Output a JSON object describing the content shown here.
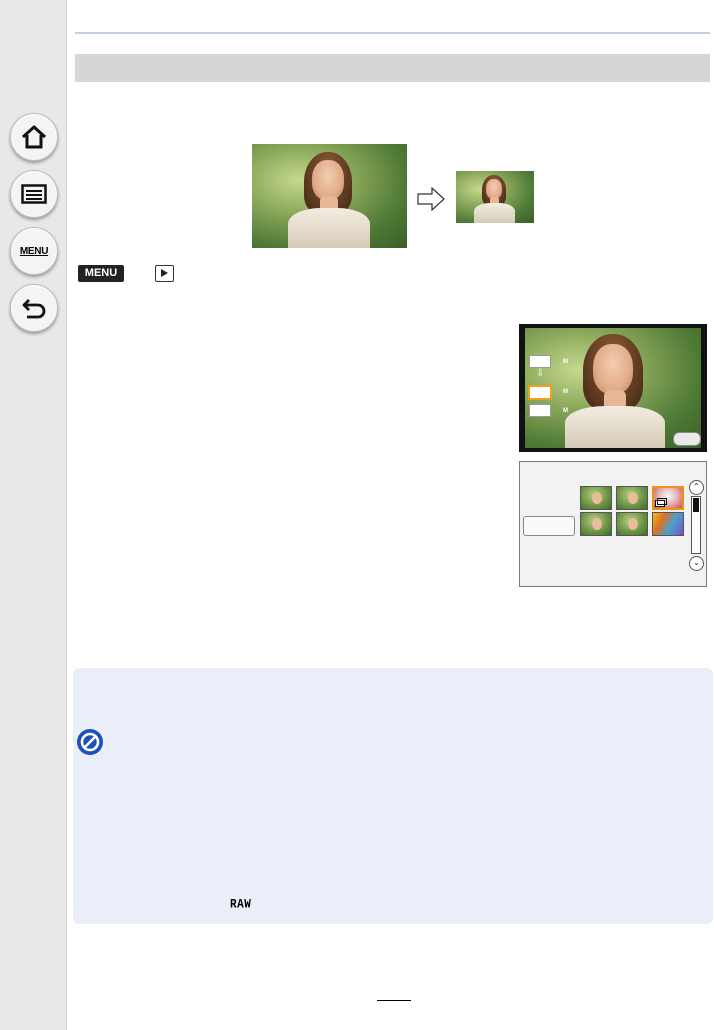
{
  "navigation": {
    "home": {
      "icon": "home-icon"
    },
    "contents": {
      "icon": "list-icon"
    },
    "menu": {
      "label": "MENU",
      "icon": "menu-icon"
    },
    "back": {
      "icon": "back-arrow-icon"
    }
  },
  "header": {
    "title": ""
  },
  "instruction": {
    "menu_badge": "MENU",
    "playback_icon": "playback-icon"
  },
  "screen_resize": {
    "size_mark": "M"
  },
  "notes": {
    "prohibit_icon": "prohibit-icon",
    "raw_label": "RAW"
  },
  "colors": {
    "accent": "#1f4fb8",
    "selection": "#f0a020",
    "note_background": "#e9eef8",
    "header_background": "#d6d6d6"
  }
}
